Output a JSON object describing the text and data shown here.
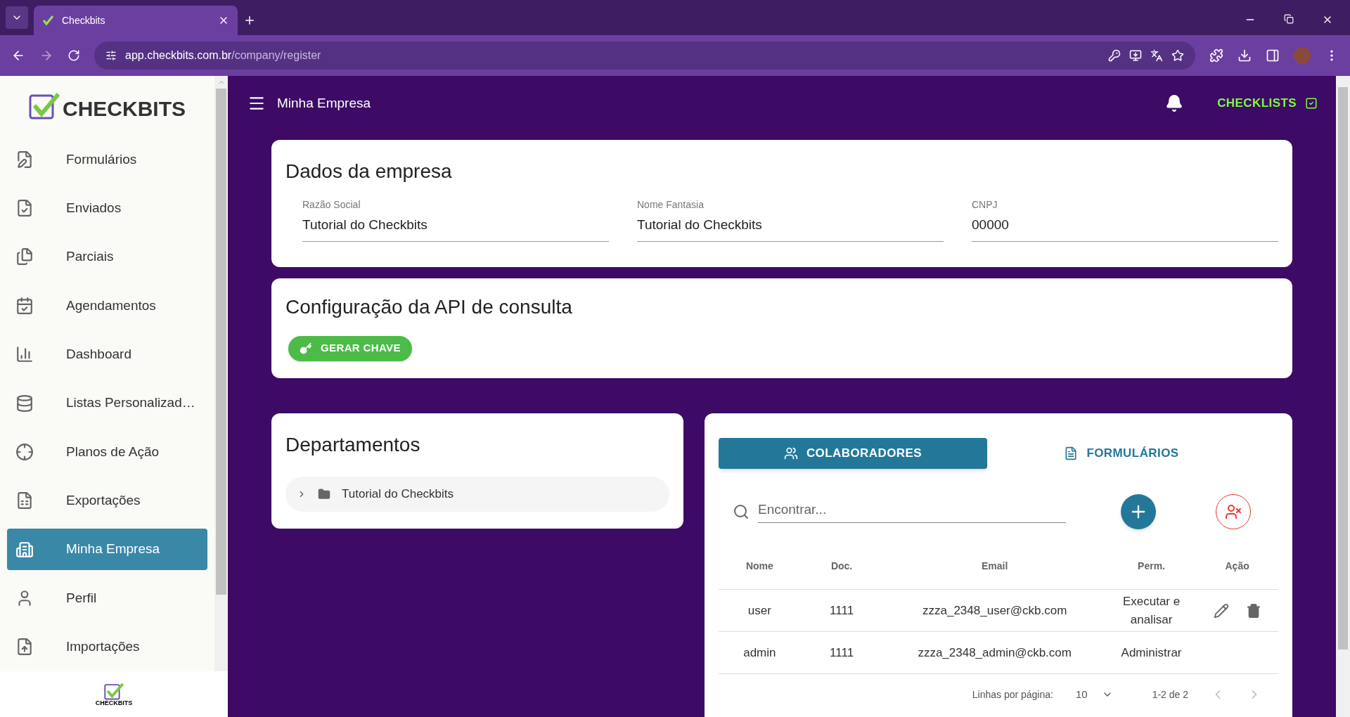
{
  "browser": {
    "tab_title": "Checkbits",
    "url_host": "app.checkbits.com.br",
    "url_path": "/company/register"
  },
  "sidebar": {
    "logo": "CHECKBITS",
    "items": [
      {
        "label": "Formulários",
        "selected": false
      },
      {
        "label": "Enviados",
        "selected": false
      },
      {
        "label": "Parciais",
        "selected": false
      },
      {
        "label": "Agendamentos",
        "selected": false
      },
      {
        "label": "Dashboard",
        "selected": false
      },
      {
        "label": "Listas Personalizad…",
        "selected": false
      },
      {
        "label": "Planos de Ação",
        "selected": false
      },
      {
        "label": "Exportações",
        "selected": false
      },
      {
        "label": "Minha Empresa",
        "selected": true
      },
      {
        "label": "Perfil",
        "selected": false
      },
      {
        "label": "Importações",
        "selected": false
      }
    ],
    "footer_logo": "CHECKBITS"
  },
  "header": {
    "title": "Minha Empresa",
    "checklists_button": "CHECKLISTS"
  },
  "company": {
    "title": "Dados da empresa",
    "fields": [
      {
        "label": "Razão Social",
        "value": "Tutorial do Checkbits"
      },
      {
        "label": "Nome Fantasia",
        "value": "Tutorial do Checkbits"
      },
      {
        "label": "CNPJ",
        "value": "00000"
      }
    ]
  },
  "api": {
    "title": "Configuração da API de consulta",
    "button": "GERAR CHAVE"
  },
  "departments": {
    "title": "Departamentos",
    "items": [
      {
        "label": "Tutorial do Checkbits",
        "expanded": false
      }
    ]
  },
  "people": {
    "tabs": [
      {
        "label": "COLABORADORES",
        "selected": true
      },
      {
        "label": "FORMULÁRIOS",
        "selected": false
      }
    ],
    "search": {
      "placeholder": "Encontrar..."
    },
    "table": {
      "columns": [
        "Nome",
        "Doc.",
        "Email",
        "Perm.",
        "Ação"
      ],
      "rows": [
        {
          "cells": [
            "user",
            "1111",
            "zzza_2348_user@ckb.com",
            "Executar e analisar"
          ],
          "editable": true
        },
        {
          "cells": [
            "admin",
            "1111",
            "zzza_2348_admin@ckb.com",
            "Administrar"
          ],
          "editable": false
        }
      ]
    },
    "pagination": {
      "rows_label": "Linhas por página:",
      "rows_value": "10",
      "range": "1-2 de 2"
    }
  }
}
